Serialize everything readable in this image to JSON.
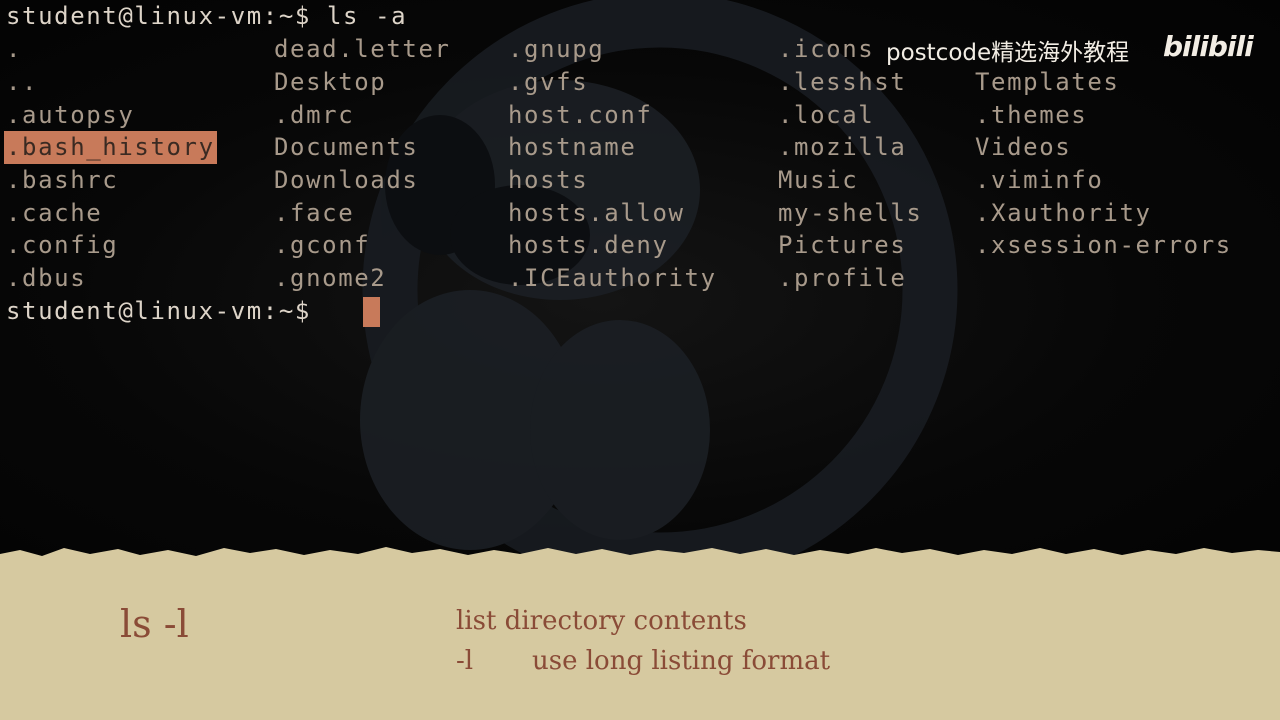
{
  "terminal": {
    "prompt_line_1": "student@linux-vm:~$ ls -a",
    "prompt_line_2": "student@linux-vm:~$ ",
    "columns": [
      [
        ".",
        "..",
        ".autopsy",
        ".bash_history",
        ".bashrc",
        ".cache",
        ".config",
        ".dbus"
      ],
      [
        "dead.letter",
        "Desktop",
        ".dmrc",
        "Documents",
        "Downloads",
        ".face",
        ".gconf",
        ".gnome2"
      ],
      [
        ".gnupg",
        ".gvfs",
        "host.conf",
        "hostname",
        "hosts",
        "hosts.allow",
        "hosts.deny",
        ".ICEauthority"
      ],
      [
        ".icons",
        ".lesshst",
        ".local",
        ".mozilla",
        "Music",
        "my-shells",
        "Pictures",
        ".profile"
      ],
      [
        "",
        "Templates",
        ".themes",
        "Videos",
        ".viminfo",
        ".Xauthority",
        ".xsession-errors",
        ""
      ]
    ],
    "highlighted_entry": ".bash_history"
  },
  "watermark": {
    "text": "postcode精选海外教程",
    "logo": "bilibili"
  },
  "caption": {
    "command": "ls -l",
    "description": "list directory contents",
    "flag": "-l",
    "flag_description": "use long listing format"
  },
  "colors": {
    "terminal_text": "#a89a8b",
    "prompt_text": "#ddd4c8",
    "highlight": "#c87a5a",
    "paper": "#d6c9a0",
    "caption_text": "#8a4b37"
  }
}
